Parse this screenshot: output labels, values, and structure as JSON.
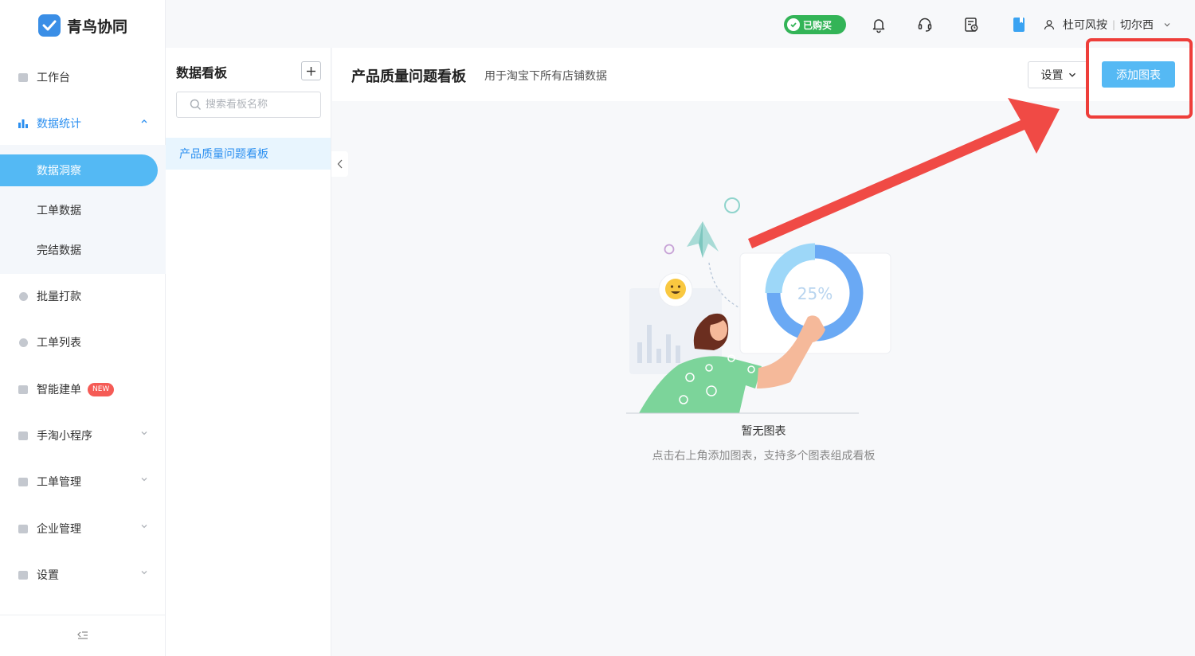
{
  "app": {
    "name": "青鸟协同"
  },
  "sidebar": {
    "items": [
      {
        "label": "工作台"
      },
      {
        "label": "数据统计"
      },
      {
        "label": "批量打款"
      },
      {
        "label": "工单列表"
      },
      {
        "label": "智能建单",
        "badge": "NEW"
      },
      {
        "label": "手淘小程序"
      },
      {
        "label": "工单管理"
      },
      {
        "label": "企业管理"
      },
      {
        "label": "设置"
      }
    ],
    "sub_items": [
      {
        "label": "数据洞察"
      },
      {
        "label": "工单数据"
      },
      {
        "label": "完结数据"
      }
    ]
  },
  "header": {
    "purchased_label": "已购买",
    "user_shop": "杜可风按",
    "user_name": "切尔西"
  },
  "panel": {
    "title": "数据看板",
    "search_placeholder": "搜索看板名称",
    "boards": [
      {
        "label": "产品质量问题看板"
      }
    ]
  },
  "main": {
    "board_title": "产品质量问题看板",
    "board_desc": "用于淘宝下所有店铺数据",
    "settings_label": "设置",
    "add_chart_label": "添加图表",
    "illustration_percent": "25%",
    "empty_title": "暂无图表",
    "empty_desc": "点击右上角添加图表，支持多个图表组成看板"
  },
  "colors": {
    "accent": "#2b8ff0",
    "primary_button": "#55b9f4",
    "purchased_green": "#33b457",
    "annotation_red": "#ee3e3a"
  }
}
